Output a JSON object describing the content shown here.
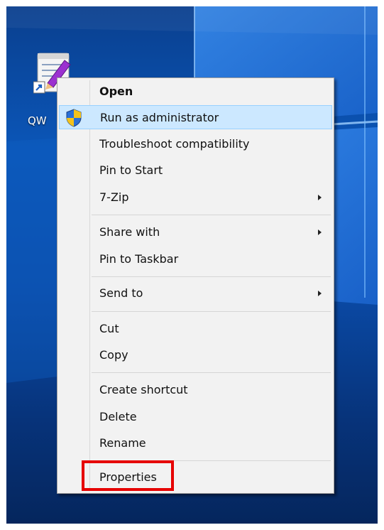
{
  "desktop": {
    "icon_label": "QW",
    "icon_name": "notepad-pencil-shortcut-icon"
  },
  "context_menu": {
    "items": [
      {
        "label": "Open",
        "bold": true
      },
      {
        "label": "Run as administrator",
        "icon": "uac-shield-icon",
        "highlighted": true
      },
      {
        "label": "Troubleshoot compatibility"
      },
      {
        "label": "Pin to Start"
      },
      {
        "label": "7-Zip",
        "submenu": true
      },
      {
        "label": "Share with",
        "submenu": true
      },
      {
        "label": "Pin to Taskbar"
      },
      {
        "label": "Send to",
        "submenu": true
      },
      {
        "label": "Cut"
      },
      {
        "label": "Copy"
      },
      {
        "label": "Create shortcut"
      },
      {
        "label": "Delete"
      },
      {
        "label": "Rename"
      },
      {
        "label": "Properties",
        "annotated": true
      }
    ]
  },
  "colors": {
    "hover_background": "#cce8ff",
    "hover_border": "#99d1ff",
    "annotation": "#e60000",
    "menu_background": "#f2f2f2"
  }
}
